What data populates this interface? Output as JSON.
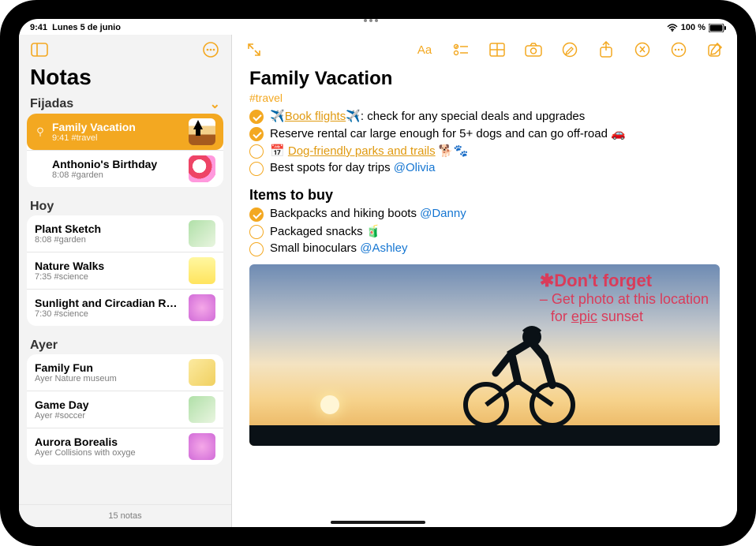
{
  "status": {
    "time": "9:41",
    "date": "Lunes 5 de junio",
    "battery": "100 %"
  },
  "sidebar": {
    "title": "Notas",
    "footer": "15 notas",
    "sections": [
      {
        "header": "Fijadas",
        "collapsible": true,
        "items": [
          {
            "title": "Family Vacation",
            "subtitle": "9:41  #travel",
            "selected": true,
            "pinned": true,
            "thumb": "t1"
          },
          {
            "title": "Anthonio's Birthday",
            "subtitle": "8:08  #garden",
            "thumb": "t2"
          }
        ]
      },
      {
        "header": "Hoy",
        "items": [
          {
            "title": "Plant Sketch",
            "subtitle": "8:08  #garden",
            "thumb": "t3"
          },
          {
            "title": "Nature Walks",
            "subtitle": "7:35  #science",
            "thumb": "t4"
          },
          {
            "title": "Sunlight and Circadian Rhy…",
            "subtitle": "7:30  #science",
            "thumb": "t5"
          }
        ]
      },
      {
        "header": "Ayer",
        "items": [
          {
            "title": "Family Fun",
            "subtitle": "Ayer  Nature museum",
            "thumb": "t6"
          },
          {
            "title": "Game Day",
            "subtitle": "Ayer  #soccer",
            "thumb": "t3"
          },
          {
            "title": "Aurora Borealis",
            "subtitle": "Ayer  Collisions with oxyge",
            "thumb": "t5"
          }
        ]
      }
    ]
  },
  "note": {
    "title": "Family Vacation",
    "tag": "#travel",
    "checklist1": [
      {
        "done": true,
        "pre": "✈️",
        "link": "Book flights",
        "post": "✈️: check for any special deals and upgrades"
      },
      {
        "done": true,
        "text": "Reserve rental car large enough for 5+ dogs and can go off-road 🚗"
      },
      {
        "done": false,
        "pre": "📅 ",
        "link": "Dog-friendly parks and trails",
        "post": " 🐕🐾"
      },
      {
        "done": false,
        "text": "Best spots for day trips ",
        "mention": "@Olivia"
      }
    ],
    "section2": "Items to buy",
    "checklist2": [
      {
        "done": true,
        "text": "Backpacks and hiking boots ",
        "mention": "@Danny"
      },
      {
        "done": false,
        "text": "Packaged snacks 🧃"
      },
      {
        "done": false,
        "text": "Small binoculars ",
        "mention": "@Ashley"
      }
    ],
    "handwritten": {
      "line1": "✱Don't forget",
      "line2": "– Get photo at this location",
      "line3": "for epic sunset"
    }
  }
}
